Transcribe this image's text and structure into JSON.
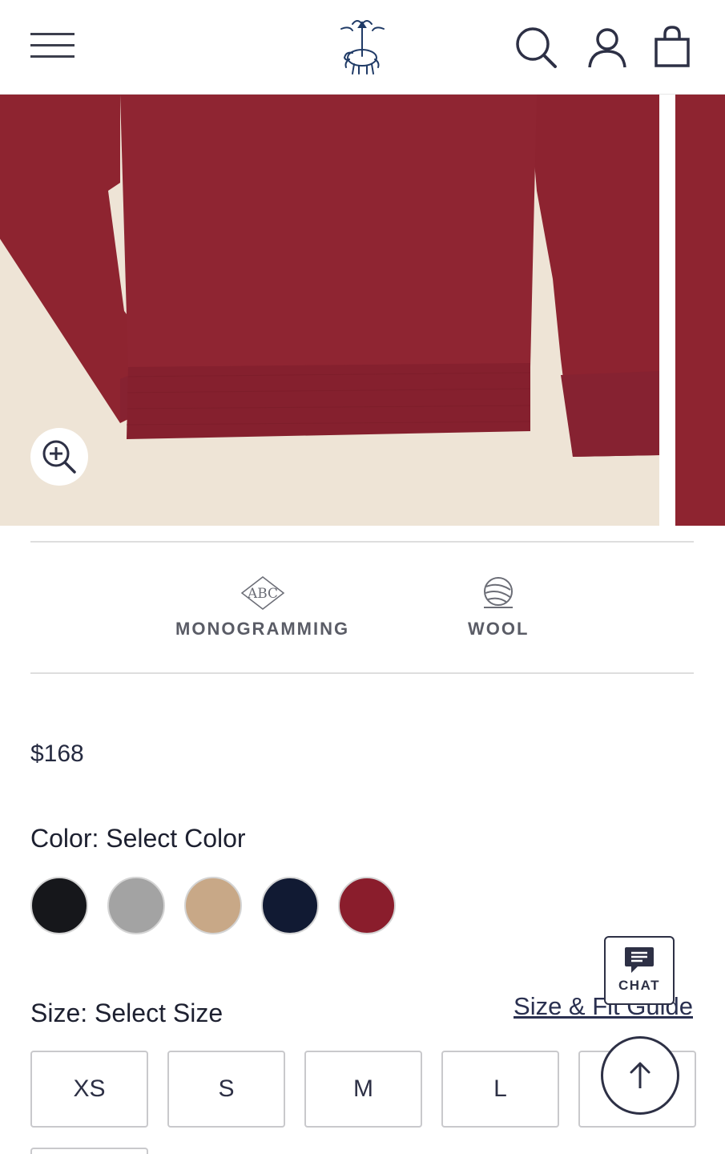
{
  "header": {
    "menu_icon": "hamburger-menu-icon",
    "logo": "brand-logo-golden-fleece",
    "search_icon": "search-icon",
    "account_icon": "account-icon",
    "bag_icon": "shopping-bag-icon"
  },
  "gallery": {
    "product_color": "#8e2430",
    "background_color": "#eee4d6",
    "zoom_icon": "zoom-in-icon"
  },
  "features": [
    {
      "label": "MONOGRAMMING",
      "icon": "monogram-abc-icon"
    },
    {
      "label": "WOOL",
      "icon": "yarn-ball-icon"
    }
  ],
  "price": "$168",
  "color": {
    "label": "Color:",
    "value": "Select Color",
    "swatches": [
      {
        "name": "black",
        "hex": "#16171b"
      },
      {
        "name": "grey",
        "hex": "#a3a3a3"
      },
      {
        "name": "camel",
        "hex": "#c8a887"
      },
      {
        "name": "navy",
        "hex": "#111a33"
      },
      {
        "name": "burgundy",
        "hex": "#8a1d2c"
      }
    ]
  },
  "size": {
    "label": "Size:",
    "value": "Select Size",
    "guide_link": "Size & Fit Guide",
    "options": [
      "XS",
      "S",
      "M",
      "L",
      ""
    ]
  },
  "chat": {
    "label": "CHAT",
    "icon": "chat-bubble-icon"
  },
  "back_to_top": {
    "icon": "arrow-up-icon"
  }
}
